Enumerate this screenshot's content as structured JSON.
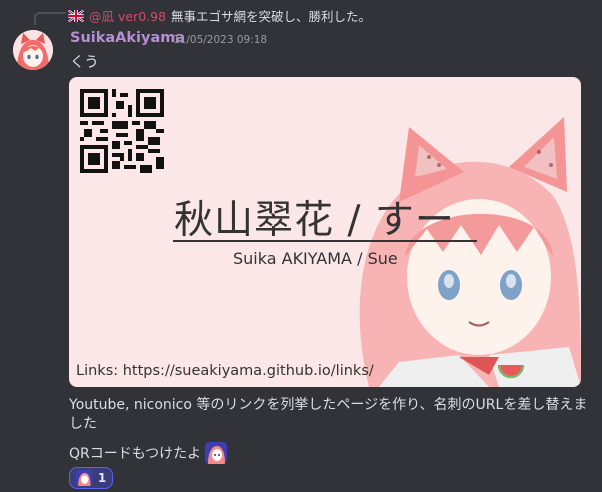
{
  "reply": {
    "author": "@凪 ver0.98",
    "text": "無事エゴサ網を突破し、勝利した。"
  },
  "message": {
    "username": "SuikaAkiyama",
    "timestamp": "11/05/2023 09:18",
    "text": "くう"
  },
  "card": {
    "name_jp": "秋山翠花 / すー",
    "name_roman": "Suika AKIYAMA / Sue",
    "links": "Links: https://sueakiyama.github.io/links/"
  },
  "body": {
    "line1": "Youtube, niconico 等のリンクを列挙したページを作り、名刺のURLを差し替えました",
    "line2": "QRコードもつけたよ"
  },
  "reaction": {
    "count": "1"
  },
  "colors": {
    "bg": "#313338",
    "username": "#b68fd6",
    "reply_name": "#d44a6a",
    "reaction_border": "#5865f2"
  }
}
